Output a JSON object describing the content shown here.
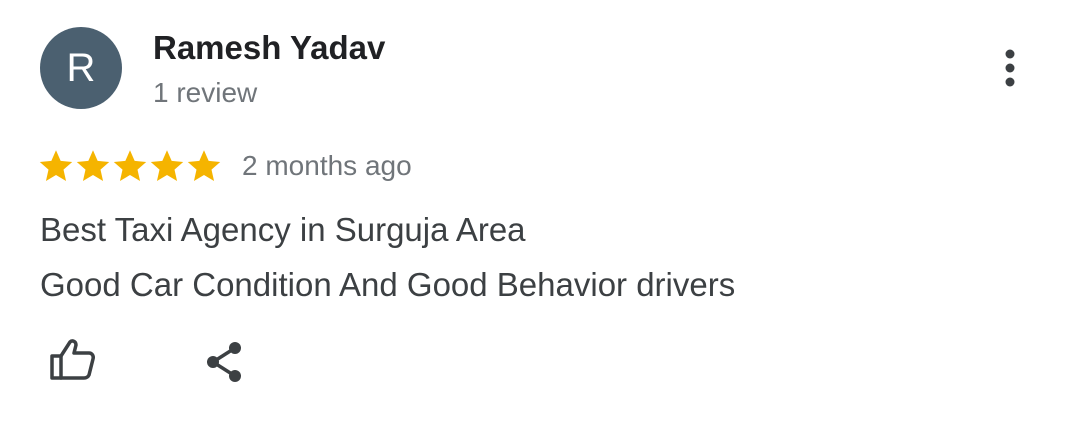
{
  "review": {
    "avatar_initial": "R",
    "author_name": "Ramesh Yadav",
    "review_count": "1 review",
    "rating": 5,
    "rating_max": 5,
    "date": "2 months ago",
    "text_lines": [
      "Best Taxi Agency in Surguja Area",
      "Good Car Condition And Good Behavior drivers"
    ]
  },
  "icons": {
    "more": "more-vert-icon",
    "like": "thumb-up-icon",
    "share": "share-icon",
    "star": "star-icon"
  },
  "colors": {
    "avatar_bg": "#4b6070",
    "star": "#f5b400",
    "icon": "#3c4043",
    "secondary_text": "#70757a"
  }
}
